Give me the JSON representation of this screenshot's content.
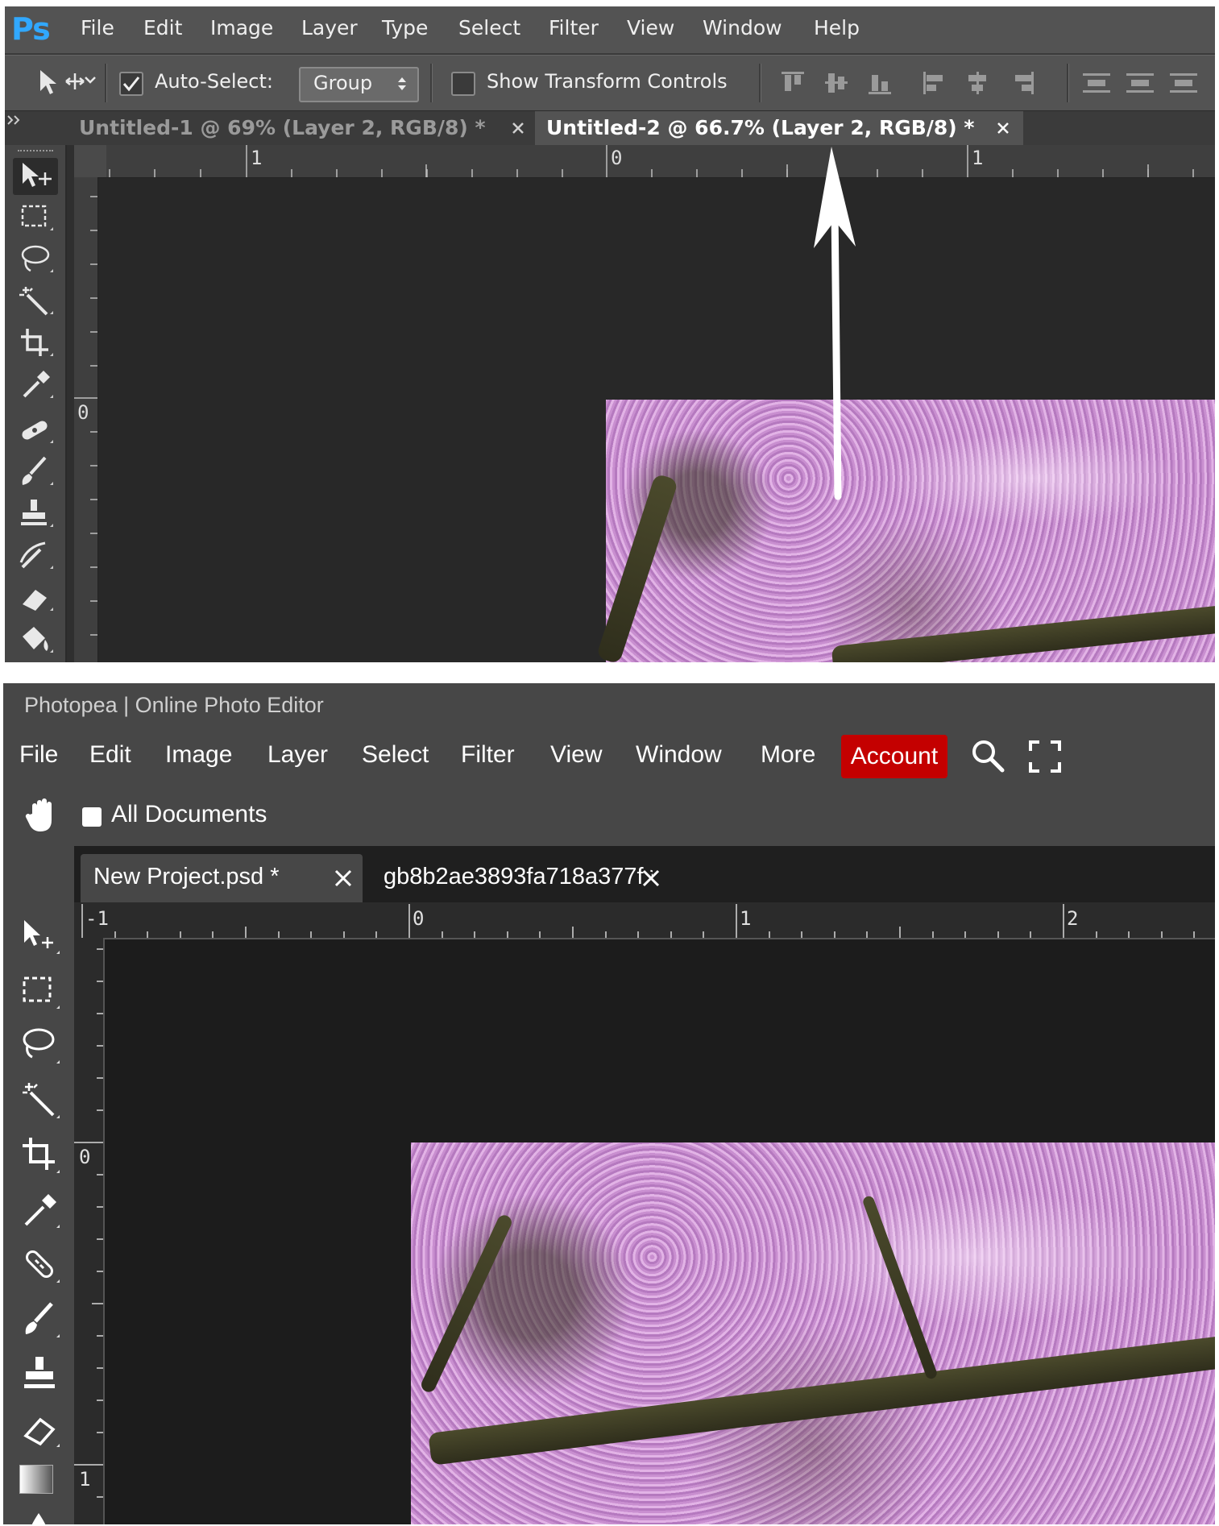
{
  "photoshop": {
    "logo": "Ps",
    "menu": [
      "File",
      "Edit",
      "Image",
      "Layer",
      "Type",
      "Select",
      "Filter",
      "View",
      "Window",
      "Help"
    ],
    "options": {
      "move_tool_icon": "move-tool-icon",
      "auto_select_label": "Auto-Select:",
      "auto_select_checked": true,
      "auto_select_value": "Group",
      "show_transform_label": "Show Transform Controls",
      "show_transform_checked": false
    },
    "tabs": [
      {
        "label": "Untitled-1 @ 69% (Layer 2, RGB/8) *",
        "active": false
      },
      {
        "label": "Untitled-2 @ 66.7% (Layer 2, RGB/8) *",
        "active": true
      }
    ],
    "ruler_top": [
      "1",
      "0",
      "1"
    ],
    "ruler_left": [
      "0"
    ],
    "tools": [
      "move-tool-icon",
      "marquee-tool-icon",
      "lasso-tool-icon",
      "magic-wand-icon",
      "crop-tool-icon",
      "eyedropper-icon",
      "healing-brush-icon",
      "brush-tool-icon",
      "clone-stamp-icon",
      "history-brush-icon",
      "eraser-icon",
      "paint-bucket-icon"
    ]
  },
  "photopea": {
    "title": "Photopea | Online Photo Editor",
    "menu": [
      "File",
      "Edit",
      "Image",
      "Layer",
      "Select",
      "Filter",
      "View",
      "Window",
      "More"
    ],
    "account_label": "Account",
    "colors": {
      "account": "#c40000",
      "ps_accent": "#31a8ff"
    },
    "options": {
      "all_documents_label": "All Documents",
      "all_documents_checked": false
    },
    "tabs": [
      {
        "label": "New Project.psd *",
        "active": true
      },
      {
        "label": "gb8b2ae3893fa718a377f *",
        "active": false
      }
    ],
    "ruler_top": [
      "-1",
      "0",
      "1",
      "2"
    ],
    "ruler_left": [
      "0",
      "1"
    ],
    "tools": [
      "move-tool-icon",
      "marquee-tool-icon",
      "lasso-tool-icon",
      "magic-wand-icon",
      "crop-tool-icon",
      "eyedropper-icon",
      "healing-brush-icon",
      "brush-tool-icon",
      "clone-stamp-icon",
      "eraser-icon",
      "gradient-tool-icon",
      "blur-tool-icon"
    ]
  }
}
